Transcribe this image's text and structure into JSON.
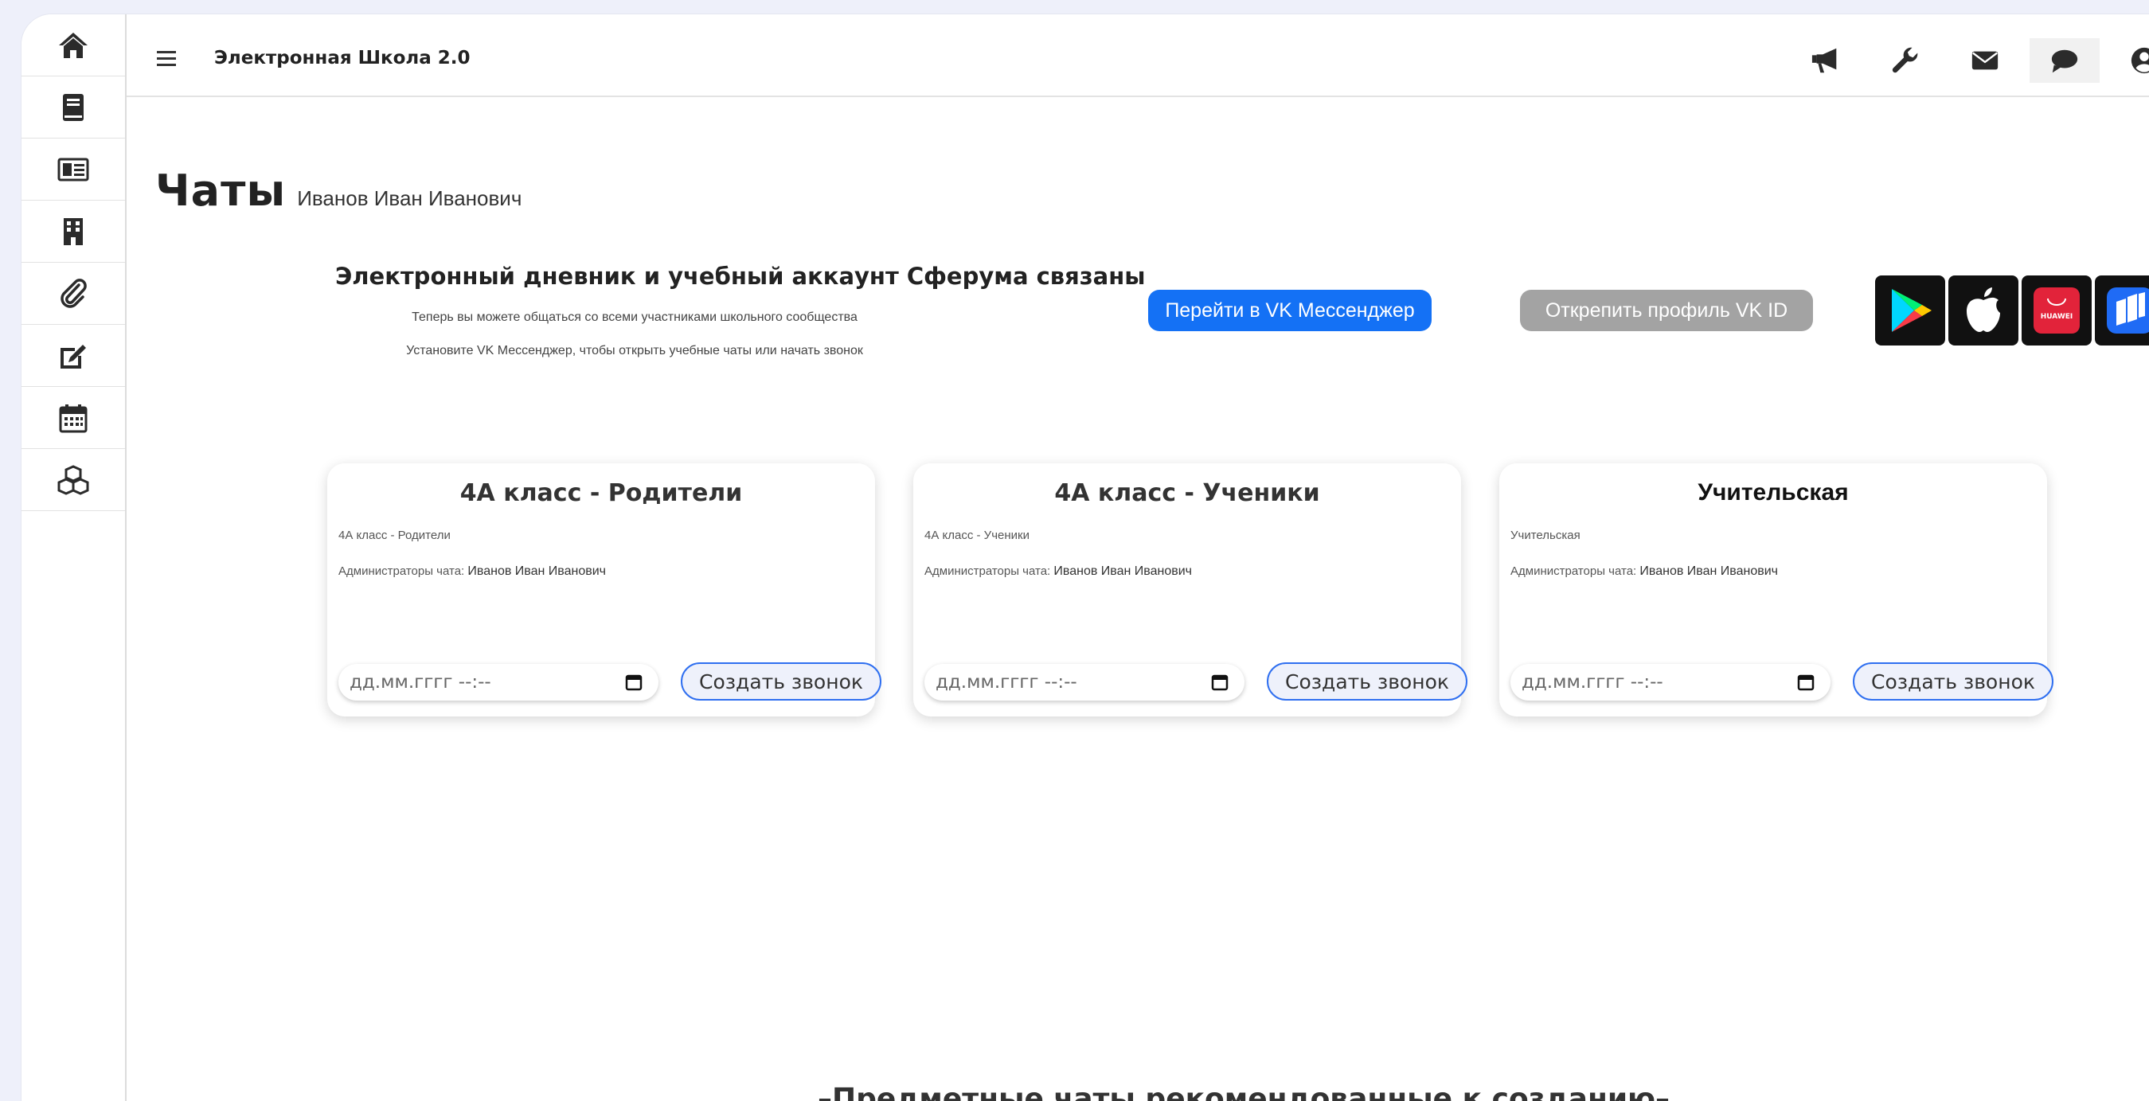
{
  "header": {
    "app_title": "Электронная Школа 2.0",
    "icons": [
      "megaphone-icon",
      "wrench-icon",
      "envelope-icon",
      "chat-bubble-icon",
      "user-circle-icon"
    ]
  },
  "sidebar": {
    "items": [
      {
        "icon": "home-icon"
      },
      {
        "icon": "book-icon"
      },
      {
        "icon": "id-card-icon"
      },
      {
        "icon": "building-icon"
      },
      {
        "icon": "paperclip-icon"
      },
      {
        "icon": "edit-icon"
      },
      {
        "icon": "calendar-icon"
      },
      {
        "icon": "cubes-icon"
      }
    ]
  },
  "page": {
    "title": "Чаты",
    "user_name": "Иванов Иван Иванович"
  },
  "vk_banner": {
    "heading": "Электронный дневник и учебный аккаунт Сферума связаны",
    "line1": "Теперь вы можете общаться со всеми участниками школьного сообщества",
    "line2": "Установите VK Мессенджер, чтобы открыть учебные чаты или начать звонок",
    "open_button": "Перейти в VK Мессенджер",
    "unlink_button": "Открепить профиль VK ID",
    "stores": [
      "google-play-icon",
      "apple-icon",
      "huawei-appgallery-icon",
      "rustore-icon"
    ],
    "huawei_label": "HUAWEI"
  },
  "cards": [
    {
      "title": "4А класс - Родители",
      "subtitle": "4А класс - Родители",
      "admins_label": "Администраторы чата:",
      "admins": "Иванов Иван Иванович",
      "date_placeholder": "дд.мм.гггг --:--",
      "call_button": "Создать звонок"
    },
    {
      "title": "4А класс - Ученики",
      "subtitle": "4А класс - Ученики",
      "admins_label": "Администраторы чата:",
      "admins": "Иванов Иван Иванович",
      "date_placeholder": "дд.мм.гггг --:--",
      "call_button": "Создать звонок"
    },
    {
      "title": "Учительская",
      "subtitle": "Учительская",
      "admins_label": "Администраторы чата:",
      "admins": "Иванов Иван Иванович",
      "date_placeholder": "дд.мм.гггг --:--",
      "call_button": "Создать звонок"
    }
  ],
  "recommended": {
    "title": "–Предметные чаты рекомендованные к созданию–"
  },
  "colors": {
    "accent": "#1471f5",
    "unlink": "#a3a3a3",
    "call_border": "#2f6ff0",
    "background": "#eef0fa"
  }
}
